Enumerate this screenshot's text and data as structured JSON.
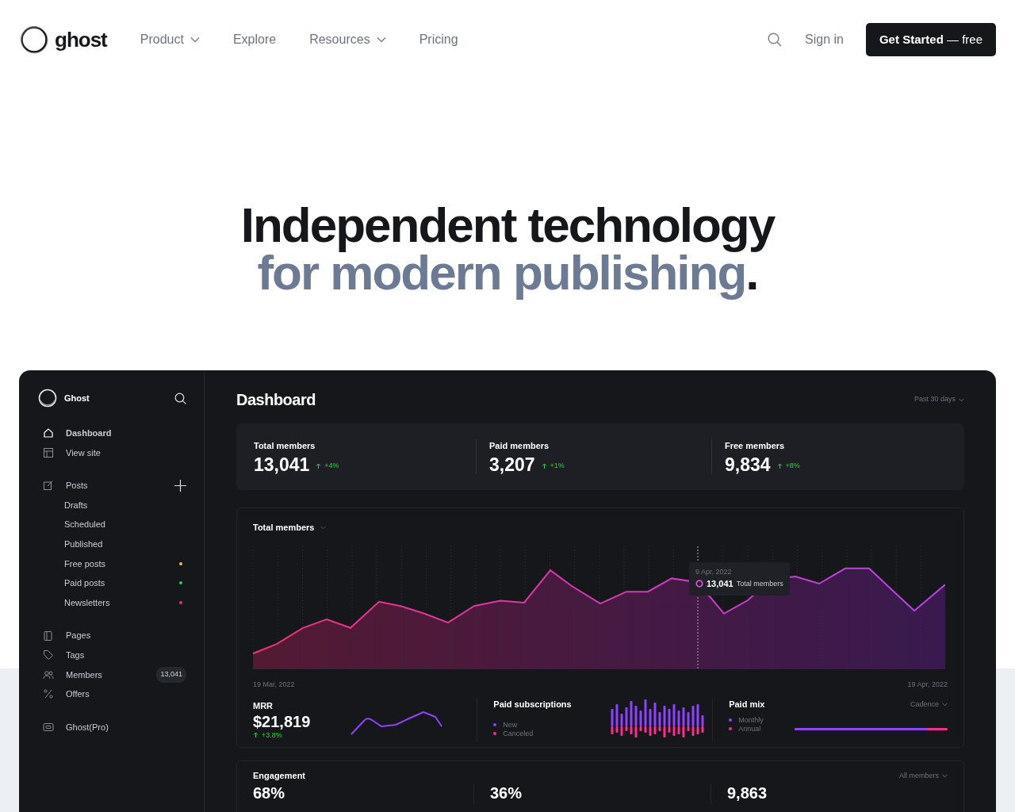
{
  "header": {
    "logo": "ghost",
    "nav": [
      {
        "label": "Product",
        "dropdown": true
      },
      {
        "label": "Explore",
        "dropdown": false
      },
      {
        "label": "Resources",
        "dropdown": true
      },
      {
        "label": "Pricing",
        "dropdown": false
      }
    ],
    "sign_in": "Sign in",
    "cta": {
      "strong": "Get Started",
      "rest": "— free"
    }
  },
  "hero": {
    "line1": "Independent technology",
    "line2": "for modern publishing",
    "period": "."
  },
  "sidebar": {
    "brand": "Ghost",
    "groups": [
      [
        {
          "label": "Dashboard",
          "kind": "main",
          "selected": true
        },
        {
          "label": "View site",
          "kind": "main",
          "selected": false
        }
      ],
      [
        {
          "label": "Posts",
          "kind": "main",
          "selected": false,
          "add": true
        },
        {
          "label": "Drafts",
          "kind": "sub",
          "selected": false
        },
        {
          "label": "Scheduled",
          "kind": "sub",
          "selected": false
        },
        {
          "label": "Published",
          "kind": "sub",
          "selected": false
        },
        {
          "label": "Free posts",
          "kind": "sub",
          "selected": false,
          "color": "#f5b83d"
        },
        {
          "label": "Paid posts",
          "kind": "sub",
          "selected": false,
          "color": "#30cf43"
        },
        {
          "label": "Newsletters",
          "kind": "sub",
          "selected": false,
          "color": "#e0316b"
        }
      ],
      [
        {
          "label": "Pages",
          "kind": "main",
          "selected": false
        },
        {
          "label": "Tags",
          "kind": "main",
          "selected": false
        },
        {
          "label": "Members",
          "kind": "main",
          "selected": false,
          "count": "13,041"
        },
        {
          "label": "Offers",
          "kind": "main",
          "selected": false
        }
      ],
      [
        {
          "label": "Ghost(Pro)",
          "kind": "main",
          "selected": false
        }
      ]
    ]
  },
  "dashboard": {
    "title": "Dashboard",
    "range": "Past 30 days",
    "stats": [
      {
        "label": "Total members",
        "value": "13,041",
        "change": "+4%"
      },
      {
        "label": "Paid members",
        "value": "3,207",
        "change": "+1%"
      },
      {
        "label": "Free members",
        "value": "9,834",
        "change": "+8%"
      }
    ],
    "members_chart": {
      "title": "Total members",
      "start_date": "19 Mar, 2022",
      "end_date": "19 Apr, 2022",
      "tooltip": {
        "date": "9 Apr, 2022",
        "value": "13,041",
        "label": "Total members"
      }
    },
    "mrr": {
      "label": "MRR",
      "value": "$21,819",
      "change": "+3.8%"
    },
    "paid_subscriptions": {
      "title": "Paid subscriptions",
      "legend": [
        {
          "label": "New",
          "color": "#8e42ff"
        },
        {
          "label": "Canceled",
          "color": "#fb2d8d"
        }
      ]
    },
    "paid_mix": {
      "title": "Paid mix",
      "filter": "Cadence",
      "legend": [
        {
          "label": "Monthly",
          "color": "#8e42ff"
        },
        {
          "label": "Annual",
          "color": "#fb2d8d"
        }
      ],
      "level": 0.87
    },
    "engagement": {
      "title": "Engagement",
      "filter": "All members",
      "values": [
        "68%",
        "36%",
        "9,863"
      ]
    }
  }
}
